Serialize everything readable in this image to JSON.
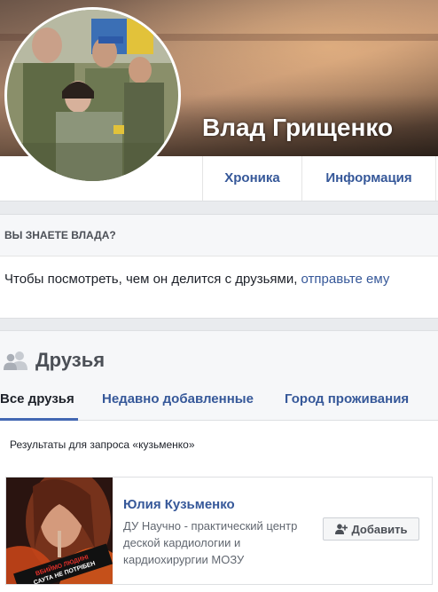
{
  "profile": {
    "name": "Влад Грищенко"
  },
  "nav": {
    "tabs": [
      {
        "label": "Хроника"
      },
      {
        "label": "Информация"
      }
    ]
  },
  "know_section": {
    "header": "ВЫ ЗНАЕТЕ ВЛАДА?",
    "text": "Чтобы посмотреть, чем он делится с друзьями, ",
    "link": "отправьте ему"
  },
  "friends": {
    "icon": "friends-icon",
    "title": "Друзья",
    "tabs": [
      {
        "label": "Все друзья",
        "active": true
      },
      {
        "label": "Недавно добавленные"
      },
      {
        "label": "Город проживания"
      }
    ],
    "results_text": "Результаты для запроса «кузьменко»",
    "items": [
      {
        "name": "Юлия Кузьменко",
        "description": "ДУ Научно - практический центр деской кардиологии и кардиохирургии МОЗУ",
        "add_label": "Добавить",
        "add_icon": "add-friend-icon",
        "photo_text_line1": "ВБИЙМО ЛЮДИНІ",
        "photo_text_line2": "САУТА НЕ ПОТРІБЕН"
      }
    ]
  },
  "colors": {
    "link": "#365899",
    "background": "#e9ebee",
    "border": "#dddfe2",
    "tab_underline": "#4267b2"
  }
}
